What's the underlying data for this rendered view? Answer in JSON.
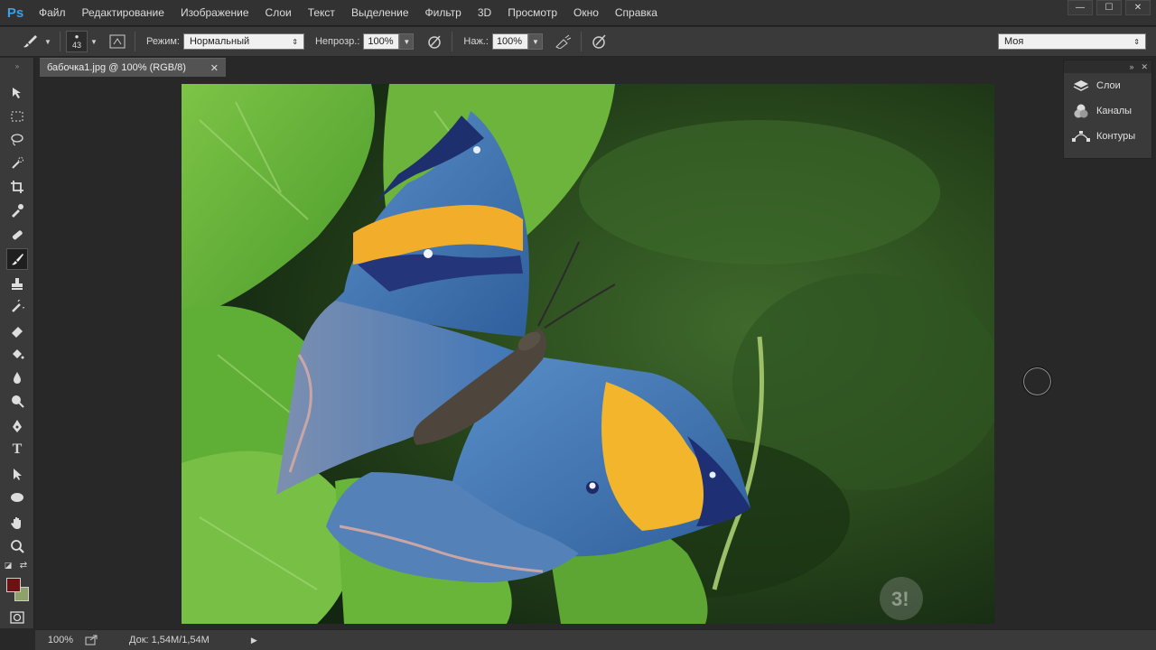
{
  "app": {
    "logo": "Ps"
  },
  "menu": [
    "Файл",
    "Редактирование",
    "Изображение",
    "Слои",
    "Текст",
    "Выделение",
    "Фильтр",
    "3D",
    "Просмотр",
    "Окно",
    "Справка"
  ],
  "window_controls": {
    "minimize": "—",
    "maximize": "☐",
    "close": "✕"
  },
  "options": {
    "brush_size": "43",
    "mode_label": "Режим:",
    "mode_value": "Нормальный",
    "opacity_label": "Непрозр.:",
    "opacity_value": "100%",
    "pressure_label": "Наж.:",
    "pressure_value": "100%",
    "workspace_value": "Моя"
  },
  "document": {
    "tab_title": "бабочка1.jpg @ 100% (RGB/8)",
    "close": "✕"
  },
  "colors": {
    "foreground": "#6d1212",
    "background": "#8ea16a",
    "accent": "#3c9fe8"
  },
  "panels": [
    {
      "label": "Слои",
      "icon": "layers-icon"
    },
    {
      "label": "Каналы",
      "icon": "channels-icon"
    },
    {
      "label": "Контуры",
      "icon": "paths-icon"
    }
  ],
  "status": {
    "zoom": "100%",
    "doc_info": "Док: 1,54M/1,54M"
  },
  "watermark": "3!"
}
